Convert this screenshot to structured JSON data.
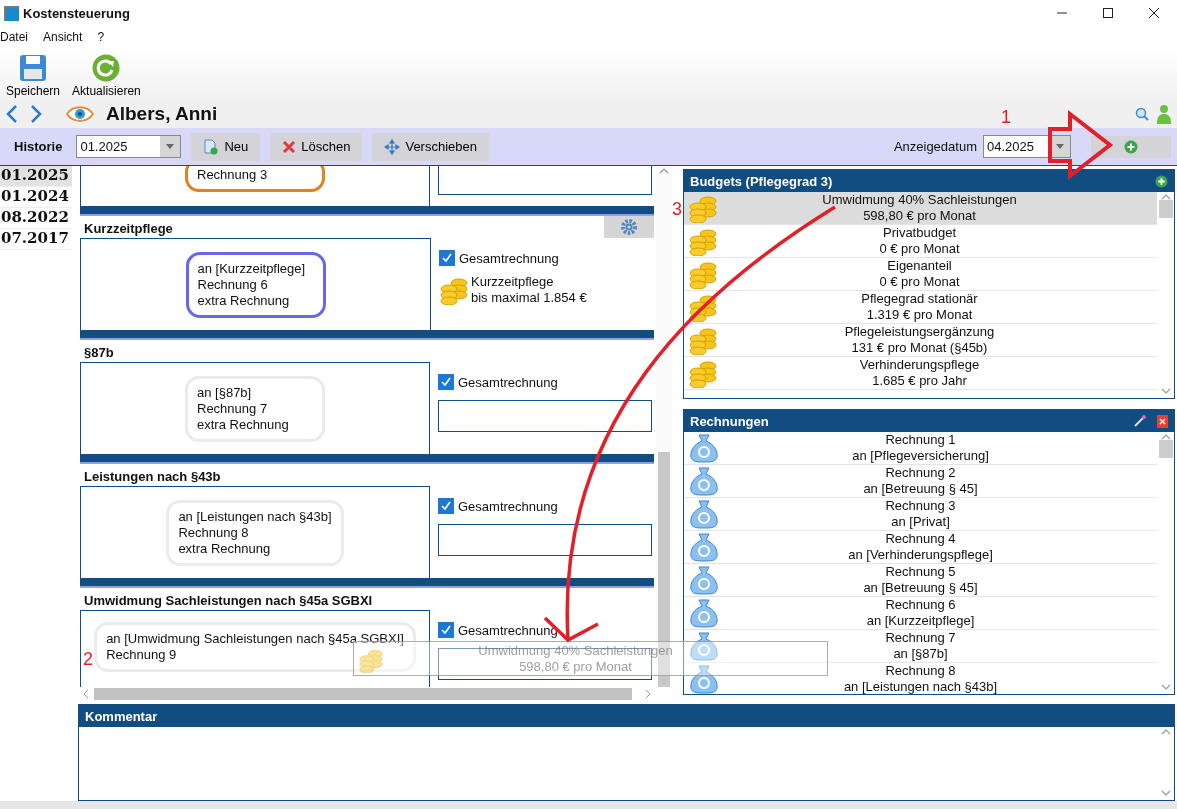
{
  "window": {
    "title": "Kostensteuerung"
  },
  "menu": [
    "Datei",
    "Ansicht",
    "?"
  ],
  "toolbar": [
    {
      "label": "Speichern",
      "kind": "save"
    },
    {
      "label": "Aktualisieren",
      "kind": "refresh"
    }
  ],
  "person": {
    "name": "Albers, Anni"
  },
  "history_bar": {
    "label": "Historie",
    "value": "01.2025",
    "date_label": "Anzeigedatum",
    "date_value": "04.2025",
    "buttons": [
      {
        "label": "Neu",
        "kind": "new"
      },
      {
        "label": "Löschen",
        "kind": "delete"
      },
      {
        "label": "Verschieben",
        "kind": "move"
      }
    ]
  },
  "history": [
    {
      "label": "01.2025",
      "selected": true
    },
    {
      "label": "01.2024",
      "selected": false
    },
    {
      "label": "08.2022",
      "selected": false
    },
    {
      "label": "07.2017",
      "selected": false
    }
  ],
  "sections": [
    {
      "card": {
        "lines": [
          "Rechnung 3"
        ],
        "color": "#e0821e"
      },
      "right": {
        "kind": "field"
      }
    },
    {
      "title": "Kurzzeitpflege",
      "settings_button": true,
      "card": {
        "lines": [
          "an [Kurzzeitpflege]",
          "Rechnung 6",
          "extra Rechnung"
        ],
        "color": "#6a66e8"
      },
      "total": {
        "label": "Gesamtrechnung",
        "checked": true
      },
      "right": {
        "kind": "budget",
        "name": "Kurzzeitpflege",
        "limit": "bis maximal 1.854 €"
      }
    },
    {
      "title": "§87b",
      "card": {
        "lines": [
          "an [§87b]",
          "Rechnung 7",
          "extra Rechnung"
        ],
        "color": "#ebebeb"
      },
      "total": {
        "label": "Gesamtrechnung",
        "checked": true
      },
      "right": {
        "kind": "field"
      }
    },
    {
      "title": "Leistungen nach §43b",
      "card": {
        "lines": [
          "an [Leistungen nach §43b]",
          "Rechnung 8",
          "extra Rechnung"
        ],
        "color": "#ebebeb"
      },
      "total": {
        "label": "Gesamtrechnung",
        "checked": true
      },
      "right": {
        "kind": "field"
      }
    },
    {
      "title": "Umwidmung Sachleistungen nach §45a SGBXI",
      "card": {
        "lines": [
          "an [Umwidmung Sachleistungen nach §45a SGBXI]",
          "Rechnung 9"
        ],
        "color": "#ebebeb"
      },
      "total": {
        "label": "Gesamtrechnung",
        "checked": true
      },
      "right": {
        "kind": "field"
      }
    }
  ],
  "drag_preview": {
    "name": "Umwidmung 40% Sachleistungen",
    "amount": "598,80 € pro Monat"
  },
  "budgets": {
    "title": "Budgets (Pflegegrad 3)",
    "items": [
      {
        "name": "Umwidmung 40% Sachleistungen",
        "amount": "598,80 € pro Monat",
        "selected": true
      },
      {
        "name": "Privatbudget",
        "amount": "0 € pro Monat",
        "selected": false
      },
      {
        "name": "Eigenanteil",
        "amount": "0 € pro Monat",
        "selected": false
      },
      {
        "name": "Pflegegrad stationär",
        "amount": "1.319 € pro Monat",
        "selected": false
      },
      {
        "name": "Pflegeleistungsergänzung",
        "amount": "131 € pro Monat (§45b)",
        "selected": false
      },
      {
        "name": "Verhinderungspflege",
        "amount": "1.685 € pro Jahr",
        "selected": false
      }
    ]
  },
  "invoices": {
    "title": "Rechnungen",
    "items": [
      {
        "name": "Rechnung 1",
        "recipient": "an [Pflegeversicherung]"
      },
      {
        "name": "Rechnung 2",
        "recipient": "an [Betreuung § 45]"
      },
      {
        "name": "Rechnung 3",
        "recipient": "an [Privat]"
      },
      {
        "name": "Rechnung 4",
        "recipient": "an [Verhinderungspflege]"
      },
      {
        "name": "Rechnung 5",
        "recipient": "an [Betreuung § 45]"
      },
      {
        "name": "Rechnung 6",
        "recipient": "an [Kurzzeitpflege]"
      },
      {
        "name": "Rechnung 7",
        "recipient": "an [§87b]"
      },
      {
        "name": "Rechnung 8",
        "recipient": "an [Leistungen nach §43b]"
      }
    ]
  },
  "comment": {
    "title": "Kommentar"
  },
  "annotations": [
    {
      "label": "1",
      "kind": "block_arrow"
    },
    {
      "label": "2",
      "kind": "target"
    },
    {
      "label": "3",
      "kind": "curved_arrow"
    }
  ]
}
